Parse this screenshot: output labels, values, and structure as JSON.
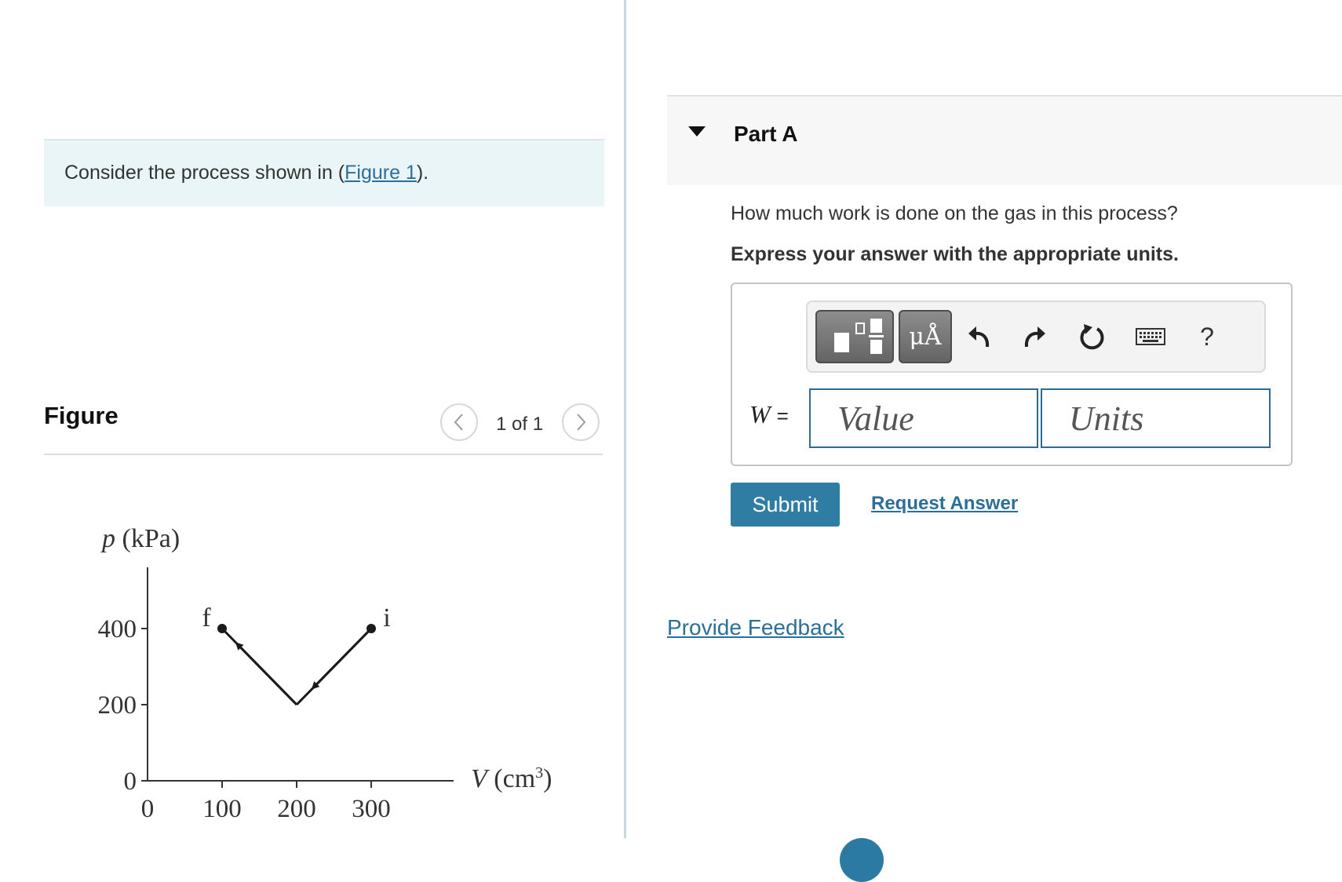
{
  "problem": {
    "intro_prefix": "Consider the process shown in (",
    "intro_link": "Figure 1",
    "intro_suffix": ")."
  },
  "figure_panel": {
    "title": "Figure",
    "page_counter": "1 of 1",
    "prev_icon": "chevron-left-icon",
    "next_icon": "chevron-right-icon"
  },
  "chart_data": {
    "type": "line",
    "ylabel_var": "p",
    "ylabel_unit": "(kPa)",
    "xlabel_var": "V",
    "xlabel_unit": "(cm",
    "xlabel_exp": "3",
    "xlabel_close": ")",
    "xlim": [
      0,
      350
    ],
    "ylim": [
      0,
      500
    ],
    "x_ticks": [
      0,
      100,
      200,
      300
    ],
    "y_ticks": [
      0,
      200,
      400
    ],
    "x_tick_labels": [
      "0",
      "100",
      "200",
      "300"
    ],
    "y_tick_labels": [
      "0",
      "200",
      "400"
    ],
    "points": [
      {
        "label": "i",
        "x": 300,
        "y": 400
      },
      {
        "x": 200,
        "y": 200
      },
      {
        "label": "f",
        "x": 100,
        "y": 400
      }
    ],
    "direction": "i to f",
    "line_color": "#1a1a1a"
  },
  "part": {
    "title": "Part A",
    "caret_icon": "caret-down-icon",
    "question": "How much work is done on the gas in this process?",
    "instruction": "Express your answer with the appropriate units."
  },
  "toolbar": {
    "templates_icon": "templates-icon",
    "units_label": "μÅ",
    "undo_icon": "undo-icon",
    "redo_icon": "redo-icon",
    "reset_icon": "reset-icon",
    "keyboard_icon": "keyboard-icon",
    "help_label": "?"
  },
  "answer": {
    "variable": "W",
    "equals": "=",
    "value_placeholder": "Value",
    "units_placeholder": "Units"
  },
  "actions": {
    "submit_label": "Submit",
    "request_answer_label": "Request Answer",
    "feedback_label": "Provide Feedback"
  },
  "colors": {
    "accent": "#2f7da3",
    "link": "#2a6f9a",
    "intro_bg": "#e9f5f6"
  }
}
